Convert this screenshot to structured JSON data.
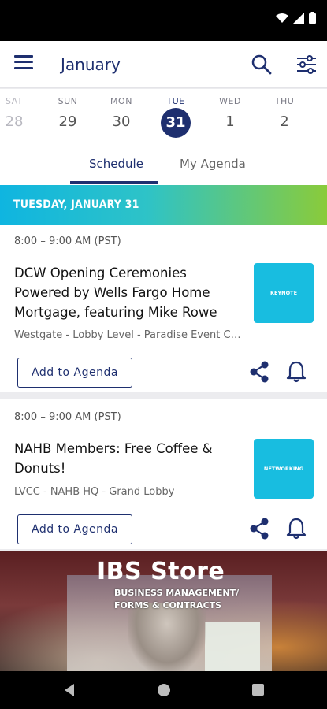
{
  "header": {
    "month": "January"
  },
  "date_strip": [
    {
      "dow": "SAT",
      "num": "28",
      "state": "past"
    },
    {
      "dow": "SUN",
      "num": "29",
      "state": "normal"
    },
    {
      "dow": "MON",
      "num": "30",
      "state": "normal"
    },
    {
      "dow": "TUE",
      "num": "31",
      "state": "selected"
    },
    {
      "dow": "WED",
      "num": "1",
      "state": "normal"
    },
    {
      "dow": "THU",
      "num": "2",
      "state": "normal"
    }
  ],
  "tabs": {
    "schedule": "Schedule",
    "my_agenda": "My Agenda",
    "active": "Schedule"
  },
  "date_banner": "Tuesday, January 31",
  "sessions": [
    {
      "time": "8:00 – 9:00 AM (PST)",
      "title": "DCW Opening Ceremonies Powered by Wells Fargo Home Mortgage, featuring Mike Rowe",
      "location": "Westgate - Lobby Level - Paradise Event Center",
      "tag": "Keynote",
      "add_label": "Add to Agenda"
    },
    {
      "time": "8:00 – 9:00 AM (PST)",
      "title": "NAHB Members: Free Coffee & Donuts!",
      "location": "LVCC - NAHB HQ - Grand Lobby",
      "tag": "Networking",
      "add_label": "Add to Agenda"
    }
  ],
  "promo": {
    "title": "IBS Store",
    "sign_line1": "Business Management/",
    "sign_line2": "Forms & Contracts"
  },
  "colors": {
    "brand_navy": "#1e2f6f",
    "tag_cyan": "#18bde0",
    "banner_start": "#0fb5e0",
    "banner_end": "#8acb3a"
  },
  "icons": {
    "menu": "hamburger-menu-icon",
    "search": "search-icon",
    "filter": "filter-sliders-icon",
    "share": "share-icon",
    "bell": "bell-icon"
  }
}
